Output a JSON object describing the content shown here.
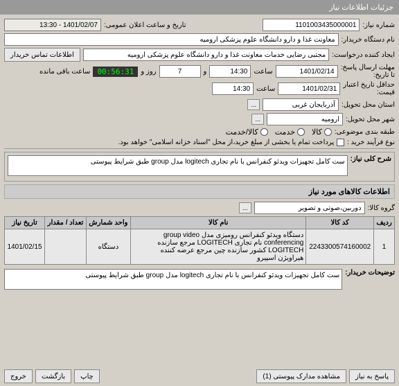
{
  "window": {
    "title": "جزئیات اطلاعات نیاز"
  },
  "fields": {
    "need_number_label": "شماره نیاز:",
    "need_number": "1101003435000001",
    "public_announce_label": "تاریخ و ساعت اعلان عمومی:",
    "public_announce": "1401/02/07 - 13:30",
    "buyer_label": "نام دستگاه خریدار:",
    "buyer": "معاونت غذا و دارو دانشگاه علوم پزشکی ارومیه",
    "requester_label": "ایجاد کننده درخواست:",
    "requester": "مجتبی رضایی خدمات معاونت غذا و دارو دانشگاه علوم پزشکی ارومیه",
    "contact_btn": "اطلاعات تماس خریدار",
    "deadline_label": "مهلت ارسال پاسخ:",
    "until_label": "تا تاریخ:",
    "deadline_date": "1401/02/14",
    "time_label": "ساعت",
    "deadline_time": "14:30",
    "days_and": "و",
    "days_val": "7",
    "days_label": "روز و",
    "countdown": "00:56:31",
    "remaining": "ساعت باقی مانده",
    "validity_label": "حداقل تاریخ اعتبار",
    "price_label": "قیمت:",
    "validity_date": "1401/02/31",
    "validity_time": "14:30",
    "province_label": "استان محل تحویل:",
    "province": "آذربایجان غربی",
    "city_label": "شهر محل تحویل:",
    "city": "ارومیه",
    "category_label": "طبقه بندی موضوعی:",
    "cat_goods": "کالا",
    "cat_service": "خدمت",
    "cat_both": "کالا/خدمت",
    "process_label": "نوع فرآیند خرید :",
    "process_text": "پرداخت تمام یا بخشی از مبلغ خرید،از محل \"اسناد خزانه اسلامی\" خواهد بود.",
    "desc_label": "شرح کلی نیاز:",
    "desc": "ست کامل تجهیزات ویدئو کنفرانس  با نام تجاری logitech مدل group طبق شرایط پیوستی",
    "items_section": "اطلاعات کالاهای مورد نیاز",
    "group_label": "گروه کالا:",
    "group": "دوربین،صوتی و تصویر",
    "th_row": "ردیف",
    "th_code": "کد کالا",
    "th_name": "نام کالا",
    "th_unit": "واحد شمارش",
    "th_qty": "تعداد / مقدار",
    "th_date": "تاریخ نیاز",
    "row1_idx": "1",
    "row1_code": "2243300574160002",
    "row1_name": "دستگاه ویدئو کنفرانس رومیزی مدل group video conferencing نام تجاری LOGITECH مرجع سازنده LOGITECH کشور سازنده چین مرجع عرضه کننده هیراویژن اسپیرو",
    "row1_unit": "دستگاه",
    "row1_date": "1401/02/15",
    "buyer_notes_label": "توضیحات خریدار:",
    "buyer_notes": "ست کامل تجهیزات ویدئو کنفرانس  با نام تجاری logitech مدل group طبق شرایط پیوستی",
    "btn_respond": "پاسخ به نیاز",
    "btn_docs": "مشاهده مدارک پیوستی (1)",
    "btn_print": "چاپ",
    "btn_back": "بازگشت",
    "btn_exit": "خروج"
  }
}
